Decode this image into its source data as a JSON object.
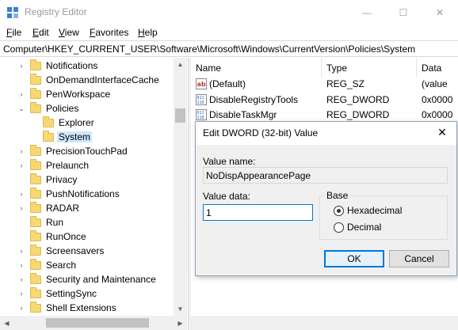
{
  "window": {
    "title": "Registry Editor",
    "minimize_glyph": "—",
    "maximize_glyph": "☐",
    "close_glyph": "✕"
  },
  "menu": [
    {
      "label": "File",
      "accel": "F",
      "rest": "ile"
    },
    {
      "label": "Edit",
      "accel": "E",
      "rest": "dit"
    },
    {
      "label": "View",
      "accel": "V",
      "rest": "iew"
    },
    {
      "label": "Favorites",
      "accel": "F",
      "rest": "avorites"
    },
    {
      "label": "Help",
      "accel": "H",
      "rest": "elp"
    }
  ],
  "address": {
    "path": "Computer\\HKEY_CURRENT_USER\\Software\\Microsoft\\Windows\\CurrentVersion\\Policies\\System"
  },
  "tree": {
    "items": [
      {
        "label": "Notifications",
        "expander": "›",
        "level": 0
      },
      {
        "label": "OnDemandInterfaceCache",
        "expander": "",
        "level": 0
      },
      {
        "label": "PenWorkspace",
        "expander": "›",
        "level": 0
      },
      {
        "label": "Policies",
        "expander": "⌄",
        "level": 0
      },
      {
        "label": "Explorer",
        "expander": "",
        "level": 1
      },
      {
        "label": "System",
        "expander": "",
        "level": 1,
        "selected": true
      },
      {
        "label": "PrecisionTouchPad",
        "expander": "›",
        "level": 0
      },
      {
        "label": "Prelaunch",
        "expander": "›",
        "level": 0
      },
      {
        "label": "Privacy",
        "expander": "",
        "level": 0
      },
      {
        "label": "PushNotifications",
        "expander": "›",
        "level": 0
      },
      {
        "label": "RADAR",
        "expander": "›",
        "level": 0
      },
      {
        "label": "Run",
        "expander": "",
        "level": 0
      },
      {
        "label": "RunOnce",
        "expander": "",
        "level": 0
      },
      {
        "label": "Screensavers",
        "expander": "›",
        "level": 0
      },
      {
        "label": "Search",
        "expander": "›",
        "level": 0
      },
      {
        "label": "Security and Maintenance",
        "expander": "›",
        "level": 0
      },
      {
        "label": "SettingSync",
        "expander": "›",
        "level": 0
      },
      {
        "label": "Shell Extensions",
        "expander": "›",
        "level": 0
      }
    ]
  },
  "list": {
    "columns": [
      "Name",
      "Type",
      "Data"
    ],
    "rows": [
      {
        "name": "(Default)",
        "type": "REG_SZ",
        "data": "(value",
        "icon": "string-value-icon"
      },
      {
        "name": "DisableRegistryTools",
        "type": "REG_DWORD",
        "data": "0x0000",
        "icon": "dword-value-icon"
      },
      {
        "name": "DisableTaskMgr",
        "type": "REG_DWORD",
        "data": "0x0000",
        "icon": "dword-value-icon"
      }
    ]
  },
  "dialog": {
    "title": "Edit DWORD (32-bit) Value",
    "value_name_label": "Value name:",
    "value_name": "NoDispAppearancePage",
    "value_data_label": "Value data:",
    "value_data": "1",
    "base_label": "Base",
    "base_options": [
      {
        "label": "Hexadecimal",
        "checked": true
      },
      {
        "label": "Decimal",
        "checked": false
      }
    ],
    "ok_label": "OK",
    "cancel_label": "Cancel"
  },
  "colors": {
    "selection": "#cce8ff",
    "focus_border": "#0078d7",
    "folder": "#f8d775"
  }
}
